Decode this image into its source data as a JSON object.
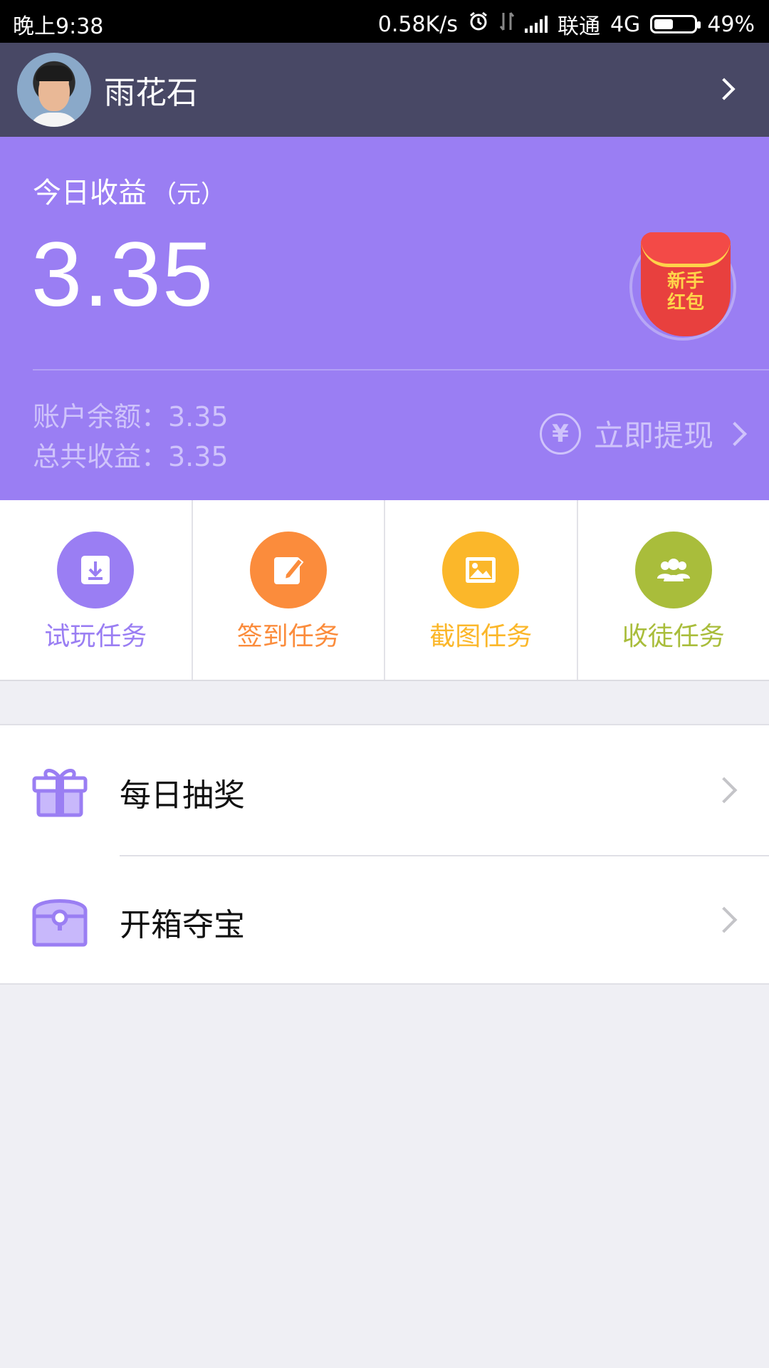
{
  "status_bar": {
    "time": "晚上9:38",
    "net_speed": "0.58K/s",
    "carrier": "联通",
    "network": "4G",
    "battery": "49%",
    "battery_level": 0.49
  },
  "profile": {
    "username": "雨花石"
  },
  "earnings": {
    "today_label": "今日收益",
    "today_unit": "（元）",
    "today_amount": "3.35",
    "red_packet_line1": "新手",
    "red_packet_line2": "红包",
    "balance_line": "账户余额：3.35",
    "total_line": "总共收益：3.35",
    "withdraw_label": "立即提现",
    "yen_symbol": "¥"
  },
  "tasks": [
    {
      "label": "试玩任务",
      "color": "#9a7ef3",
      "icon": "download-icon"
    },
    {
      "label": "签到任务",
      "color": "#fb8c3c",
      "icon": "pencil-note-icon"
    },
    {
      "label": "截图任务",
      "color": "#fbb72a",
      "icon": "image-icon"
    },
    {
      "label": "收徒任务",
      "color": "#a9bd3b",
      "icon": "group-icon"
    }
  ],
  "menu": [
    {
      "label": "每日抽奖",
      "icon": "gift-icon"
    },
    {
      "label": "开箱夺宝",
      "icon": "treasure-chest-icon"
    }
  ],
  "colors": {
    "header_bg": "#484865",
    "earnings_bg": "#9a7ef3",
    "page_bg": "#efeff4",
    "accent_purple": "#9a7ef3"
  }
}
